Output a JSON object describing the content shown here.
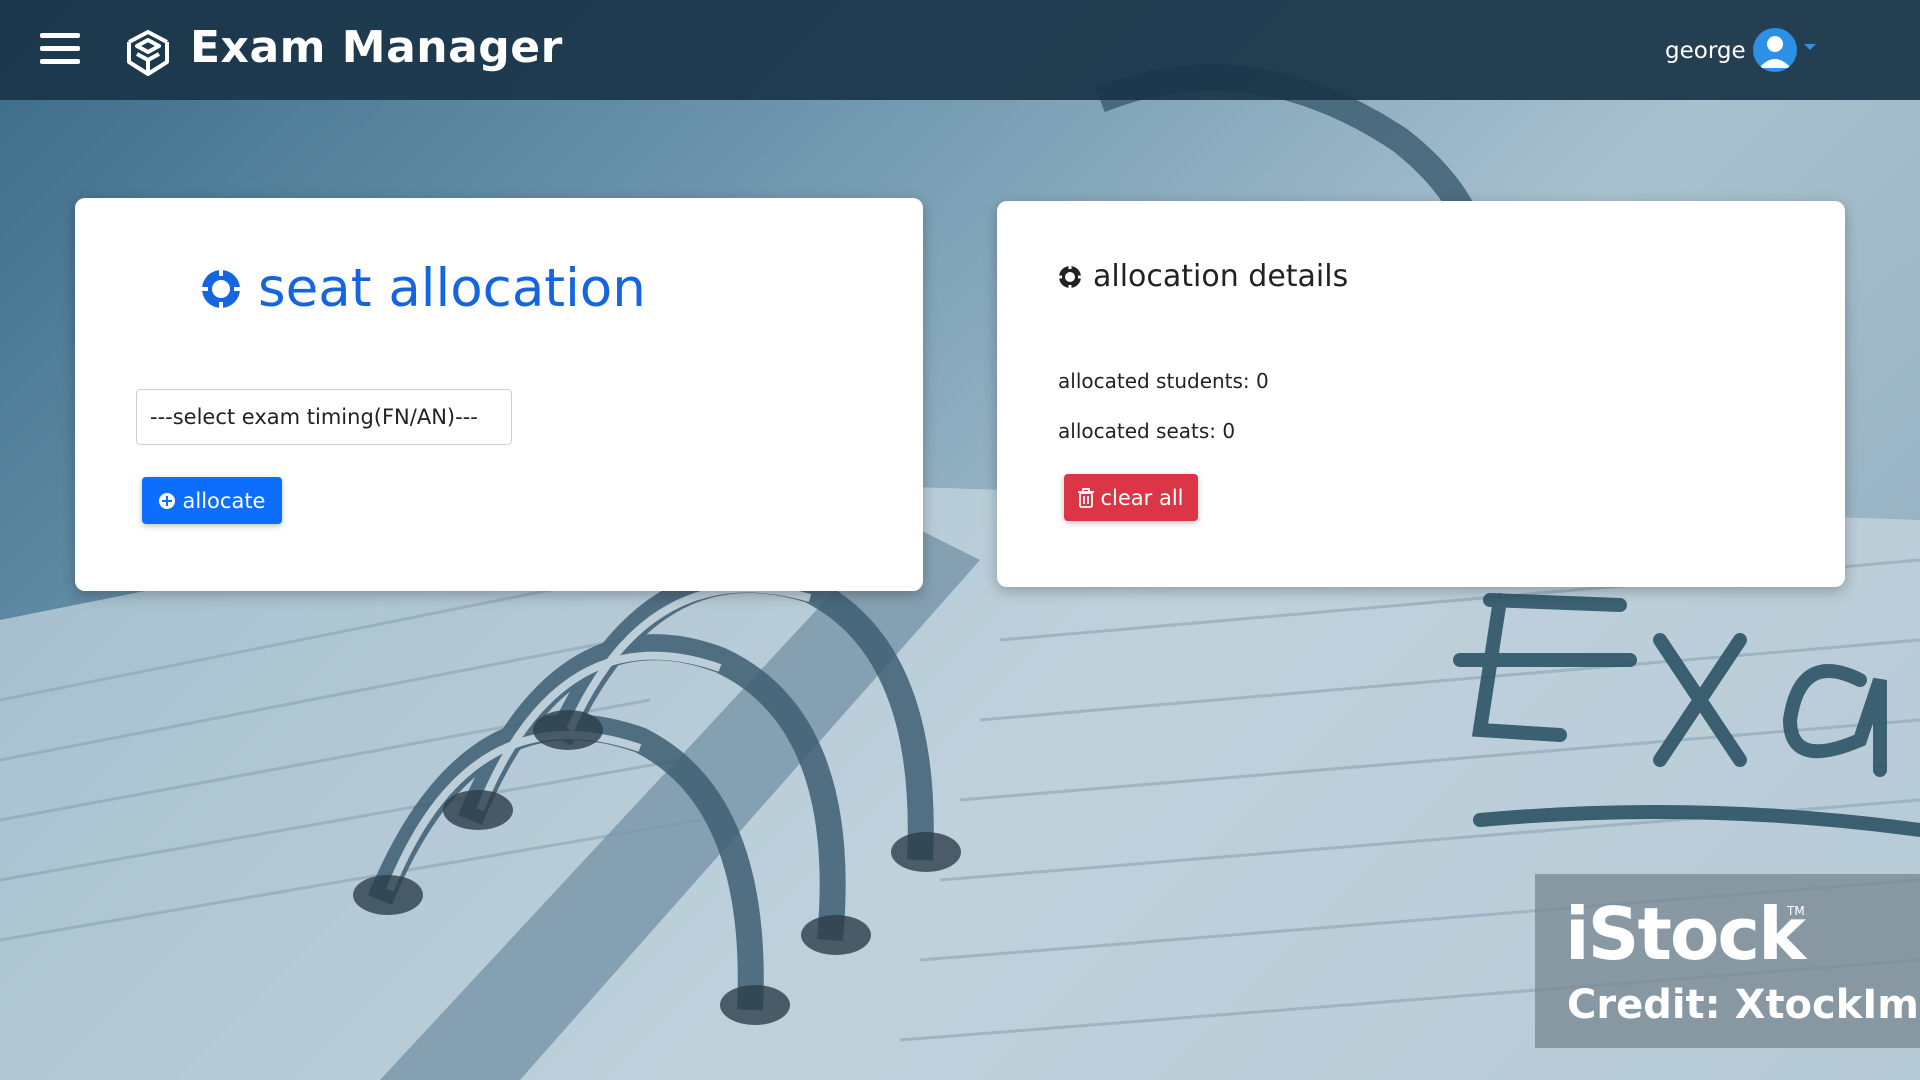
{
  "app": {
    "title": "Exam Manager"
  },
  "user": {
    "name": "george"
  },
  "allocation": {
    "title": "seat allocation",
    "select_value": "---select exam timing(FN/AN)---",
    "allocate_label": "allocate"
  },
  "details": {
    "title": "allocation details",
    "students_line": "allocated students: 0",
    "seats_line": "allocated seats: 0",
    "clear_label": "clear all"
  },
  "watermark": {
    "brand": "iStock",
    "tm": "TM",
    "credit": "Credit: XtockIma"
  },
  "colors": {
    "primary": "#0d6efd",
    "danger": "#dc3545",
    "title_blue": "#1565e0",
    "navbar": "#1a3448"
  }
}
